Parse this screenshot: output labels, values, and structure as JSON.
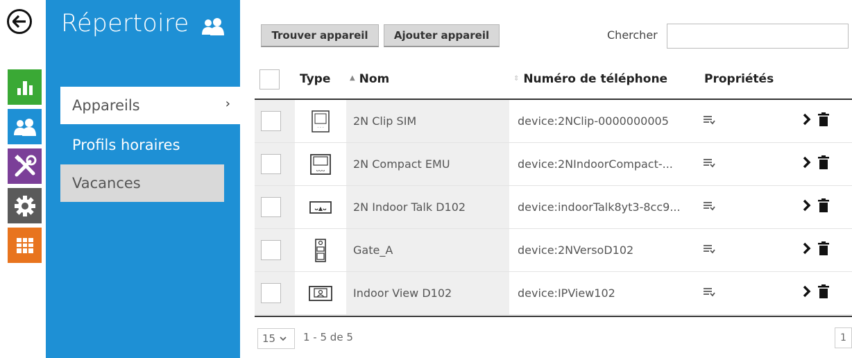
{
  "colors": {
    "sidebar_bg": "#1e90d5",
    "rail_green": "#3aa935",
    "rail_blue": "#1e90d5",
    "rail_purple": "#7b3f98",
    "rail_gray": "#5a5a5a",
    "rail_orange": "#e8741e"
  },
  "rail": [
    {
      "icon": "bar-chart-icon"
    },
    {
      "icon": "users-icon"
    },
    {
      "icon": "tools-icon"
    },
    {
      "icon": "gear-icon"
    },
    {
      "icon": "grid-icon"
    }
  ],
  "sidebar": {
    "title": "Répertoire",
    "items": [
      {
        "label": "Appareils",
        "chevron": "›"
      },
      {
        "label": "Profils horaires"
      },
      {
        "label": "Vacances"
      }
    ]
  },
  "toolbar": {
    "find_label": "Trouver appareil",
    "add_label": "Ajouter appareil",
    "search_label": "Chercher",
    "search_value": ""
  },
  "table": {
    "headers": {
      "type": "Type",
      "name": "Nom",
      "phone": "Numéro de téléphone",
      "props": "Propriétés"
    },
    "rows": [
      {
        "name": "2N Clip SIM",
        "phone": "device:2NClip-0000000005",
        "icon": "clip-device-icon"
      },
      {
        "name": "2N Compact EMU",
        "phone": "device:2NIndoorCompact-...",
        "icon": "compact-device-icon"
      },
      {
        "name": "2N Indoor Talk D102",
        "phone": "device:indoorTalk8yt3-8cc9...",
        "icon": "talk-device-icon"
      },
      {
        "name": "Gate_A",
        "phone": "device:2NVersoD102",
        "icon": "verso-device-icon"
      },
      {
        "name": "Indoor View D102",
        "phone": "device:IPView102",
        "icon": "view-device-icon"
      }
    ]
  },
  "pager": {
    "page_size": "15",
    "info": "1 - 5 de 5",
    "page": "1"
  }
}
